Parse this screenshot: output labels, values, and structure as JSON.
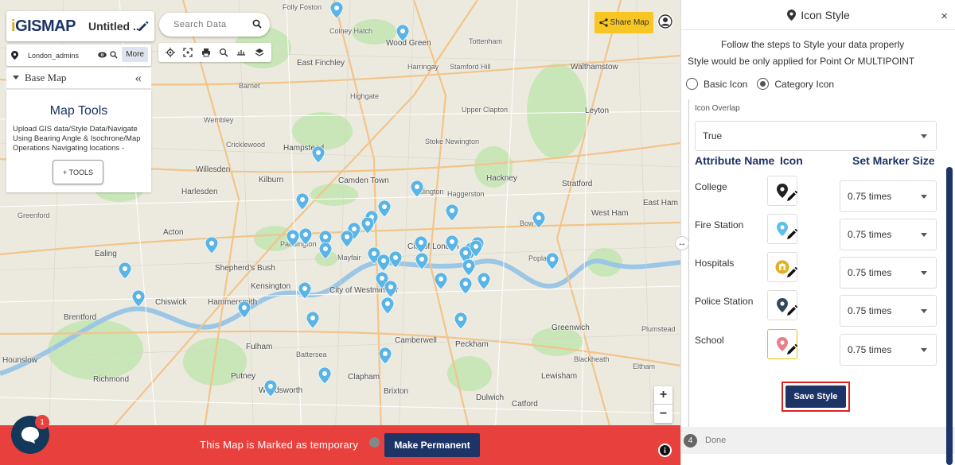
{
  "app": {
    "logo_text": "GISMAP",
    "map_title": "Untitled ...",
    "layer_name": "London_admins",
    "more_label": "More",
    "base_map_label": "Base Map",
    "collapse_glyph": "«",
    "map_tools": {
      "title": "Map Tools",
      "description": "Upload GIS data/Style Data/Navigate Using Bearing Angle & Isochrone/Map Operations Navigating locations -",
      "button_label": "+ TOOLS"
    },
    "search_placeholder": "Search Data",
    "share_label": "Share Map",
    "zoom_in": "+",
    "zoom_out": "−",
    "temp_text": "This Map is Marked as temporary",
    "make_permanent_label": "Make Permanent",
    "chat_badge_count": "1",
    "resize_glyph": "↔"
  },
  "map_labels": [
    {
      "t": "Folly Foston"
    },
    {
      "t": "Colney Hatch"
    },
    {
      "t": "Wood Green"
    },
    {
      "t": "Tottenham"
    },
    {
      "t": "East Finchley"
    },
    {
      "t": "Harringay"
    },
    {
      "t": "Stamford Hill"
    },
    {
      "t": "Walthamstow"
    },
    {
      "t": "Upper Clapton"
    },
    {
      "t": "Hampstead"
    },
    {
      "t": "Highgate"
    },
    {
      "t": "Stoke Newington"
    },
    {
      "t": "Hackney"
    },
    {
      "t": "Leyton"
    },
    {
      "t": "Stratford"
    },
    {
      "t": "Camden Town"
    },
    {
      "t": "Islington"
    },
    {
      "t": "Haggerston"
    },
    {
      "t": "Kilburn"
    },
    {
      "t": "Paddington"
    },
    {
      "t": "Mayfair"
    },
    {
      "t": "City of London"
    },
    {
      "t": "Bow"
    },
    {
      "t": "Poplar"
    },
    {
      "t": "Shepherd's Bush"
    },
    {
      "t": "Kensington"
    },
    {
      "t": "City of Westminster"
    },
    {
      "t": "Hammersmith"
    },
    {
      "t": "Chiswick"
    },
    {
      "t": "Ealing"
    },
    {
      "t": "Greenwich"
    },
    {
      "t": "Blackheath"
    },
    {
      "t": "Lewisham"
    },
    {
      "t": "Brixton"
    },
    {
      "t": "Clapham"
    },
    {
      "t": "Battersea"
    },
    {
      "t": "Putney"
    },
    {
      "t": "Wandsworth"
    },
    {
      "t": "Fulham"
    },
    {
      "t": "Richmond"
    },
    {
      "t": "Brentford"
    },
    {
      "t": "Hounslow"
    },
    {
      "t": "Willesden"
    },
    {
      "t": "Harlesden"
    },
    {
      "t": "Acton"
    },
    {
      "t": "Greenford"
    },
    {
      "t": "East Ham"
    },
    {
      "t": "West Ham"
    },
    {
      "t": "Peckham"
    },
    {
      "t": "Camberwell"
    },
    {
      "t": "Dulwich"
    },
    {
      "t": "Wembley"
    },
    {
      "t": "Cricklewood"
    },
    {
      "t": "Barnet"
    },
    {
      "t": "Plumstead"
    },
    {
      "t": "Eltham"
    },
    {
      "t": "Catford"
    }
  ],
  "panel": {
    "title": "Icon Style",
    "close_glyph": "×",
    "instruction_1": "Follow the steps to Style your data properly",
    "instruction_2": "Style would be only applied for Point Or MULTIPOINT",
    "basic_icon_label": "Basic Icon",
    "category_icon_label": "Category Icon",
    "selected_icon_type": "Category Icon",
    "icon_overlap_label": "Icon Overlap",
    "icon_overlap_value": "True",
    "col_attribute": "Attribute Name",
    "col_icon": "Icon",
    "col_marker_size": "Set Marker Size",
    "rows": [
      {
        "name": "College",
        "icon": "dark-pin-icon",
        "color": "#222222",
        "size": "0.75 times"
      },
      {
        "name": "Fire Station",
        "icon": "light-blue-pin-icon",
        "color": "#5bc0eb",
        "size": "0.75 times"
      },
      {
        "name": "Hospitals",
        "icon": "hospital-icon",
        "color": "#e0b020",
        "size": "0.75 times"
      },
      {
        "name": "Police Station",
        "icon": "navy-pin-icon",
        "color": "#34495e",
        "size": "0.75 times"
      },
      {
        "name": "School",
        "icon": "pink-pin-icon",
        "color": "#e8808a",
        "size": "0.75 times"
      }
    ],
    "save_label": "Save Style",
    "done_step": "4",
    "done_label": "Done"
  },
  "colors": {
    "brand_navy": "#1d3466",
    "share_yellow": "#f7c623",
    "temp_red": "#e8403d",
    "pin_blue": "#5ab4e6",
    "highlight_red": "#e02020"
  }
}
